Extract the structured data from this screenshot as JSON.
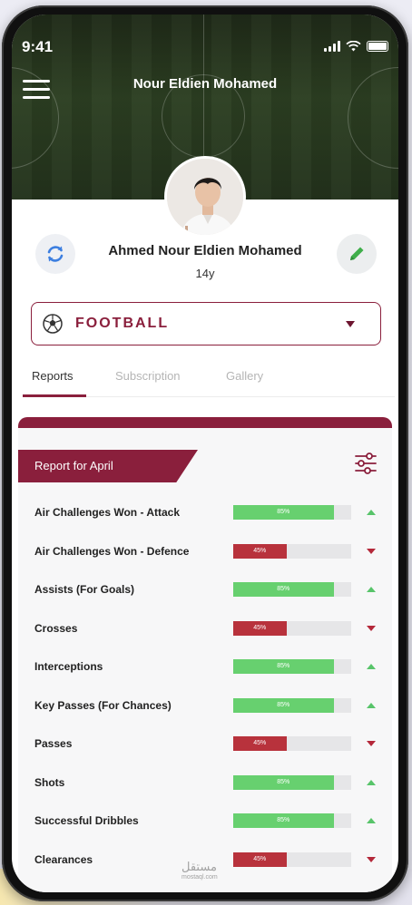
{
  "status_bar": {
    "time": "9:41"
  },
  "header": {
    "title": "Nour Eldien Mohamed"
  },
  "profile": {
    "name": "Ahmed Nour Eldien Mohamed",
    "age": "14y"
  },
  "sport_select": {
    "value": "FOOTBALL"
  },
  "tabs": [
    {
      "label": "Reports",
      "active": true
    },
    {
      "label": "Subscription",
      "active": false
    },
    {
      "label": "Gallery",
      "active": false
    }
  ],
  "report": {
    "title": "Report for April",
    "stats": [
      {
        "label": "Air Challenges Won - Attack",
        "value": 85,
        "value_label": "85%",
        "trend": "up"
      },
      {
        "label": "Air Challenges Won - Defence",
        "value": 45,
        "value_label": "45%",
        "trend": "down"
      },
      {
        "label": "Assists (For Goals)",
        "value": 85,
        "value_label": "85%",
        "trend": "up"
      },
      {
        "label": "Crosses",
        "value": 45,
        "value_label": "45%",
        "trend": "down"
      },
      {
        "label": "Interceptions",
        "value": 85,
        "value_label": "85%",
        "trend": "up"
      },
      {
        "label": "Key Passes (For Chances)",
        "value": 85,
        "value_label": "85%",
        "trend": "up"
      },
      {
        "label": "Passes",
        "value": 45,
        "value_label": "45%",
        "trend": "down"
      },
      {
        "label": "Shots",
        "value": 85,
        "value_label": "85%",
        "trend": "up"
      },
      {
        "label": "Successful Dribbles",
        "value": 85,
        "value_label": "85%",
        "trend": "up"
      },
      {
        "label": "Clearances",
        "value": 45,
        "value_label": "45%",
        "trend": "down"
      }
    ]
  },
  "colors": {
    "brand": "#8a1f3c",
    "positive": "#67d06f",
    "negative": "#b8323c"
  },
  "icons": [
    "menu-icon",
    "refresh-icon",
    "edit-icon",
    "football-icon",
    "filter-icon",
    "trend-up-icon",
    "trend-down-icon"
  ],
  "watermark": {
    "arabic": "مستقل",
    "latin": "mostaql.com"
  }
}
